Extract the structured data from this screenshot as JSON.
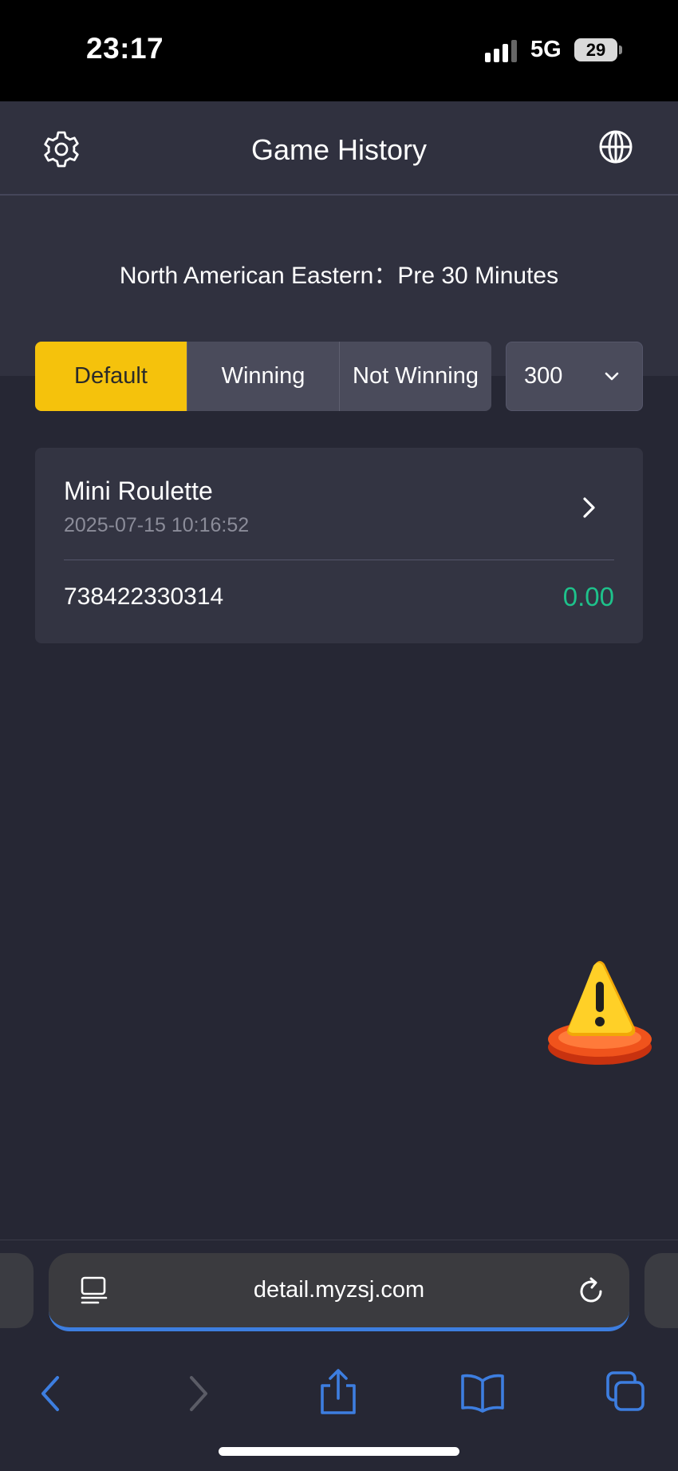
{
  "status_bar": {
    "time": "23:17",
    "network": "5G",
    "battery": "29"
  },
  "header": {
    "title": "Game History",
    "left_icon": "gear-icon",
    "right_icon": "globe-icon"
  },
  "timezone": {
    "text": "North American Eastern：Pre 30 Minutes"
  },
  "filters": {
    "tabs": [
      {
        "label": "Default",
        "active": true
      },
      {
        "label": "Winning",
        "active": false
      },
      {
        "label": "Not Winning",
        "active": false
      }
    ],
    "count_select": {
      "value": "300"
    }
  },
  "records": [
    {
      "game_name": "Mini Roulette",
      "time": "2025-07-15 10:16:52",
      "bet_id": "738422330314",
      "amount": "0.00"
    }
  ],
  "browser": {
    "url": "detail.myzsj.com"
  },
  "colors": {
    "accent": "#f5c20c",
    "win_amount": "#1ec28b",
    "background": "#262734",
    "panel": "#30313f",
    "browser_accent": "#3d7ee0"
  }
}
